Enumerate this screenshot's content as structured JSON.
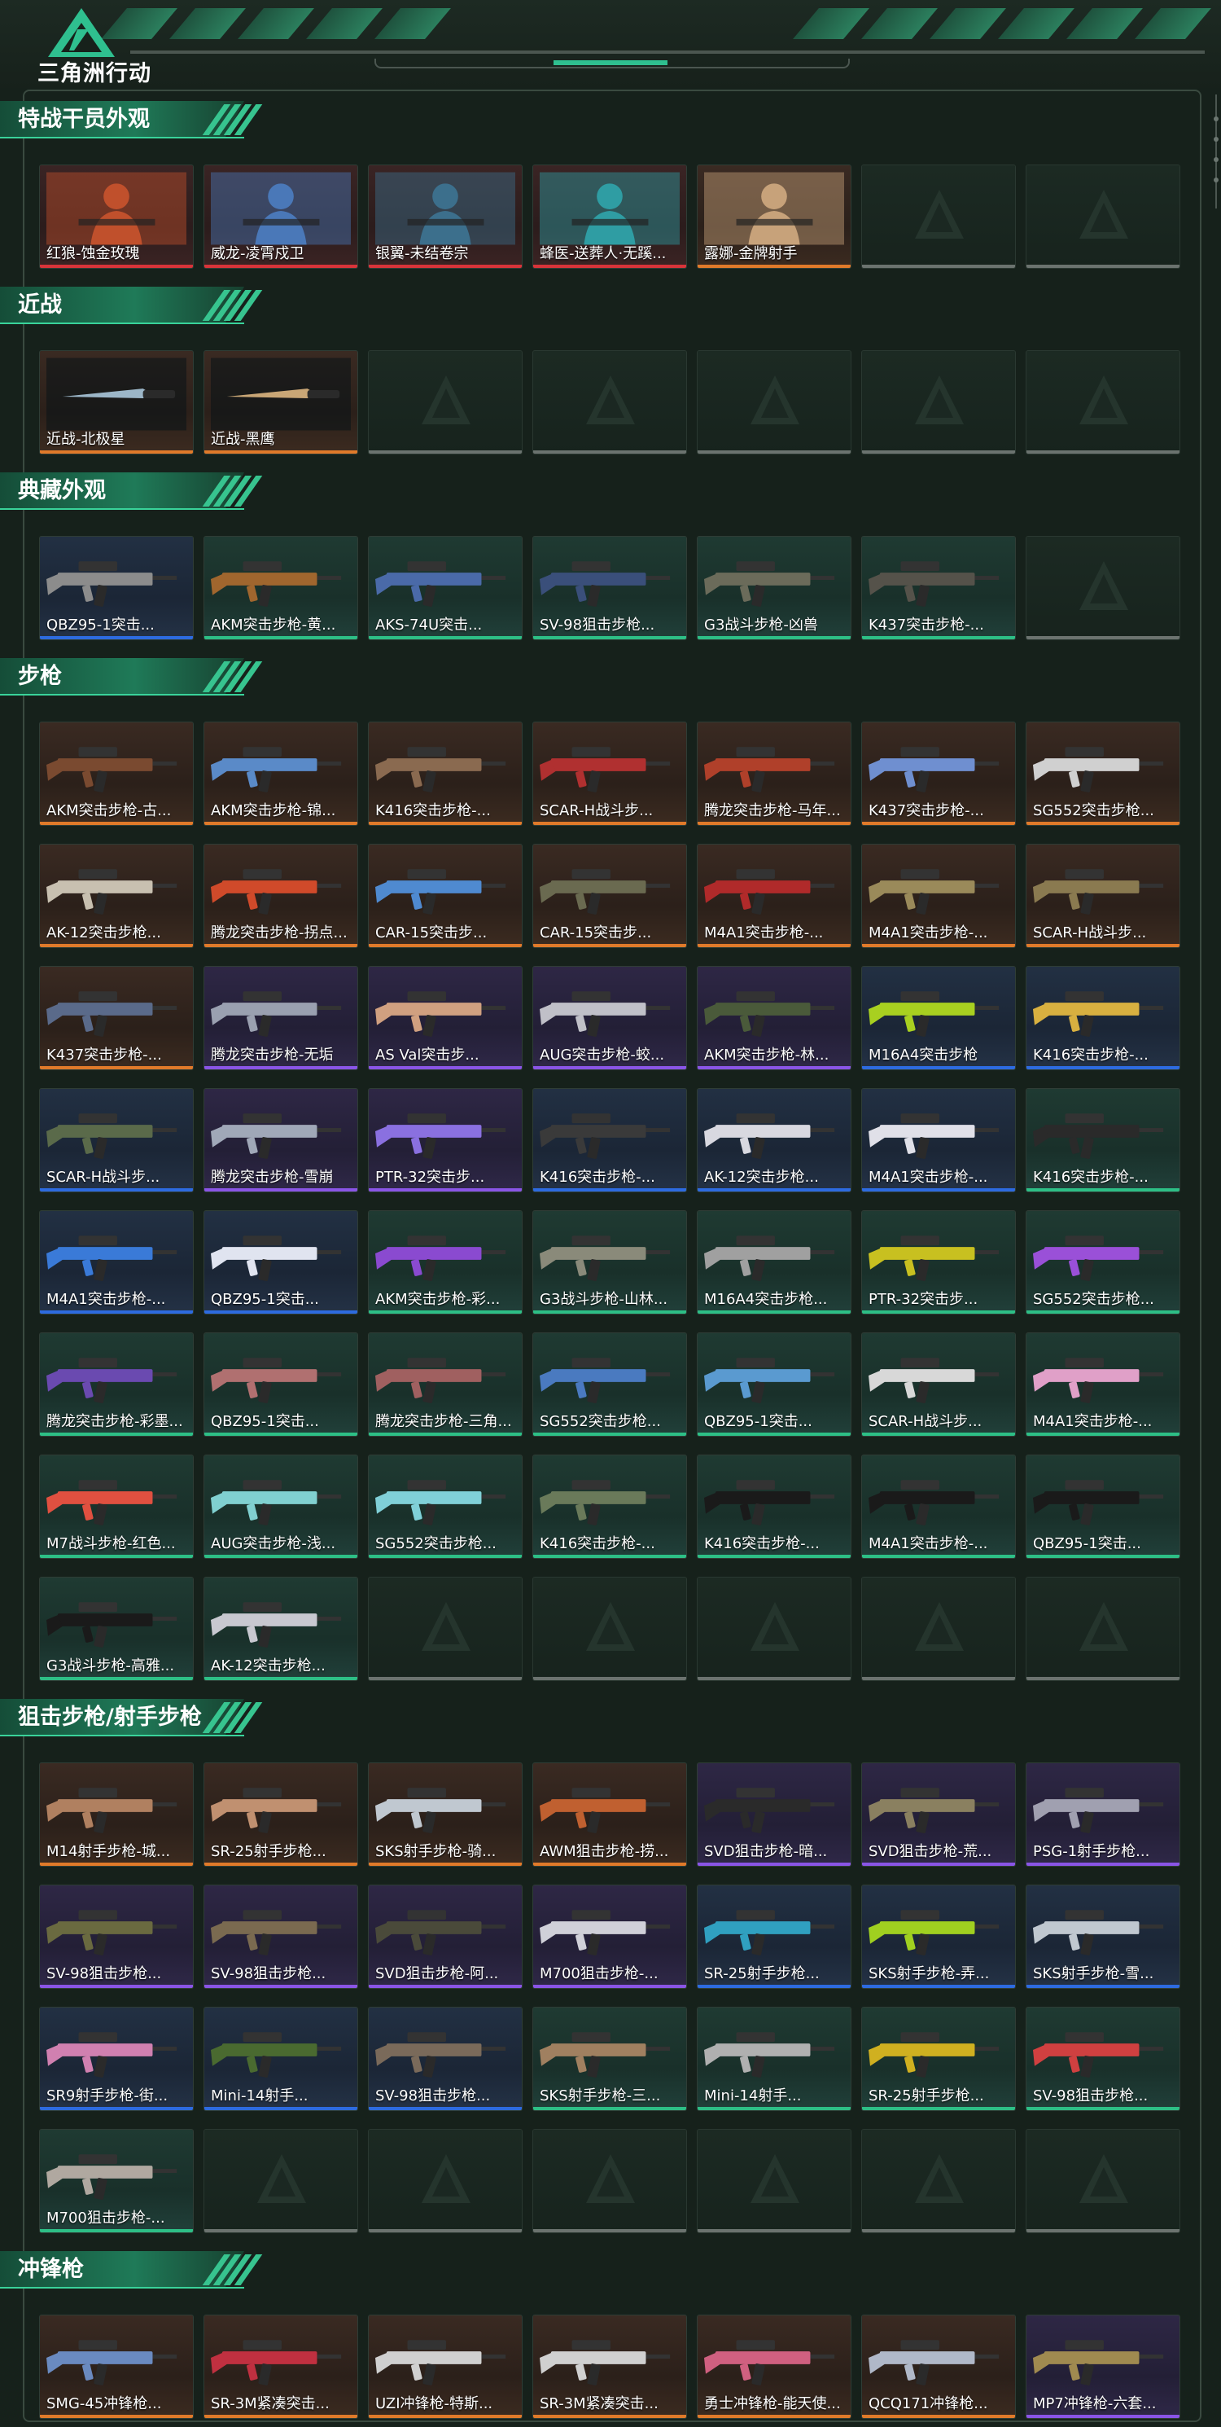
{
  "header": {
    "logo_text": "三角洲行动"
  },
  "colors": {
    "accent": "#2fbf8f",
    "rarity_orange": "#e07a2a",
    "rarity_purple": "#8a55e6",
    "rarity_blue": "#2d6be0",
    "rarity_green": "#2dbf86",
    "rarity_red": "#d8343a"
  },
  "sections": [
    {
      "title": "特战干员外观",
      "items": [
        {
          "name": "红狼-蚀金玫瑰",
          "rarity": "red",
          "kind": "operator",
          "color": "#c0502c"
        },
        {
          "name": "威龙-凌霄戍卫",
          "rarity": "red",
          "kind": "operator",
          "color": "#4a78b8"
        },
        {
          "name": "银翼-未结卷宗",
          "rarity": "red",
          "kind": "operator",
          "color": "#3c6f8c"
        },
        {
          "name": "蜂医-送葬人·无蹊...",
          "rarity": "red",
          "kind": "operator",
          "color": "#2f9da3"
        },
        {
          "name": "露娜-金牌射手",
          "rarity": "orange",
          "kind": "operator",
          "color": "#c7a27a"
        },
        {
          "empty": true
        },
        {
          "empty": true
        }
      ]
    },
    {
      "title": "近战",
      "items": [
        {
          "name": "近战-北极星",
          "rarity": "orange",
          "kind": "knife",
          "color": "#9cb6c8"
        },
        {
          "name": "近战-黑鹰",
          "rarity": "orange",
          "kind": "knife",
          "color": "#c9a676"
        },
        {
          "empty": true
        },
        {
          "empty": true
        },
        {
          "empty": true
        },
        {
          "empty": true
        },
        {
          "empty": true
        }
      ]
    },
    {
      "title": "典藏外观",
      "items": [
        {
          "name": "QBZ95-1突击...",
          "rarity": "blue",
          "kind": "gun",
          "color": "#8c8c8c"
        },
        {
          "name": "AKM突击步枪-黄...",
          "rarity": "green",
          "kind": "gun",
          "color": "#a0662e"
        },
        {
          "name": "AKS-74U突击...",
          "rarity": "green",
          "kind": "gun",
          "color": "#4a6aa8"
        },
        {
          "name": "SV-98狙击步枪...",
          "rarity": "green",
          "kind": "gun",
          "color": "#3a4f7a"
        },
        {
          "name": "G3战斗步枪-凶兽",
          "rarity": "green",
          "kind": "gun",
          "color": "#6b6b5a"
        },
        {
          "name": "K437突击步枪-...",
          "rarity": "green",
          "kind": "gun",
          "color": "#55524a"
        },
        {
          "empty": true
        }
      ]
    },
    {
      "title": "步枪",
      "items": [
        {
          "name": "AKM突击步枪-古...",
          "rarity": "orange",
          "kind": "gun",
          "color": "#7a4a30"
        },
        {
          "name": "AKM突击步枪-锦...",
          "rarity": "orange",
          "kind": "gun",
          "color": "#5a8ac8"
        },
        {
          "name": "K416突击步枪-...",
          "rarity": "orange",
          "kind": "gun",
          "color": "#8a6a50"
        },
        {
          "name": "SCAR-H战斗步...",
          "rarity": "orange",
          "kind": "gun",
          "color": "#b03030"
        },
        {
          "name": "腾龙突击步枪-马年...",
          "rarity": "orange",
          "kind": "gun",
          "color": "#b0402a"
        },
        {
          "name": "K437突击步枪-...",
          "rarity": "orange",
          "kind": "gun",
          "color": "#6f8fd0"
        },
        {
          "name": "SG552突击步枪...",
          "rarity": "orange",
          "kind": "gun",
          "color": "#d0d0d0"
        },
        {
          "name": "AK-12突击步枪...",
          "rarity": "orange",
          "kind": "gun",
          "color": "#c8c0b0"
        },
        {
          "name": "腾龙突击步枪-拐点...",
          "rarity": "orange",
          "kind": "gun",
          "color": "#d04a2a"
        },
        {
          "name": "CAR-15突击步...",
          "rarity": "orange",
          "kind": "gun",
          "color": "#4f8ad0"
        },
        {
          "name": "CAR-15突击步...",
          "rarity": "orange",
          "kind": "gun",
          "color": "#6a6a50"
        },
        {
          "name": "M4A1突击步枪-...",
          "rarity": "orange",
          "kind": "gun",
          "color": "#b02a2a"
        },
        {
          "name": "M4A1突击步枪-...",
          "rarity": "orange",
          "kind": "gun",
          "color": "#9a8a5a"
        },
        {
          "name": "SCAR-H战斗步...",
          "rarity": "orange",
          "kind": "gun",
          "color": "#8a7a50"
        },
        {
          "name": "K437突击步枪-...",
          "rarity": "orange",
          "kind": "gun",
          "color": "#5a6a8a"
        },
        {
          "name": "腾龙突击步枪-无垢",
          "rarity": "purple",
          "kind": "gun",
          "color": "#9aa0b0"
        },
        {
          "name": "AS Val突击步...",
          "rarity": "purple",
          "kind": "gun",
          "color": "#d0a080"
        },
        {
          "name": "AUG突击步枪-蛟...",
          "rarity": "purple",
          "kind": "gun",
          "color": "#c0c0c8"
        },
        {
          "name": "AKM突击步枪-林...",
          "rarity": "purple",
          "kind": "gun",
          "color": "#4a5a3a"
        },
        {
          "name": "M16A4突击步枪",
          "rarity": "blue",
          "kind": "gun",
          "color": "#a8d020"
        },
        {
          "name": "K416突击步枪-...",
          "rarity": "blue",
          "kind": "gun",
          "color": "#d8b040"
        },
        {
          "name": "SCAR-H战斗步...",
          "rarity": "blue",
          "kind": "gun",
          "color": "#5a6a4a"
        },
        {
          "name": "腾龙突击步枪-雪崩",
          "rarity": "purple",
          "kind": "gun",
          "color": "#a0a8b8"
        },
        {
          "name": "PTR-32突击步...",
          "rarity": "purple",
          "kind": "gun",
          "color": "#8a70e0"
        },
        {
          "name": "K416突击步枪-...",
          "rarity": "blue",
          "kind": "gun",
          "color": "#3a3a3a"
        },
        {
          "name": "AK-12突击步枪...",
          "rarity": "blue",
          "kind": "gun",
          "color": "#d8d8e0"
        },
        {
          "name": "M4A1突击步枪-...",
          "rarity": "blue",
          "kind": "gun",
          "color": "#e0e0e8"
        },
        {
          "name": "K416突击步枪-...",
          "rarity": "green",
          "kind": "gun",
          "color": "#2a2a2a"
        },
        {
          "name": "M4A1突击步枪-...",
          "rarity": "blue",
          "kind": "gun",
          "color": "#3a7ad8"
        },
        {
          "name": "QBZ95-1突击...",
          "rarity": "blue",
          "kind": "gun",
          "color": "#e0e4f0"
        },
        {
          "name": "AKM突击步枪-彩...",
          "rarity": "green",
          "kind": "gun",
          "color": "#8a4ad0"
        },
        {
          "name": "G3战斗步枪-山林...",
          "rarity": "green",
          "kind": "gun",
          "color": "#8a8a7a"
        },
        {
          "name": "M16A4突击步枪...",
          "rarity": "green",
          "kind": "gun",
          "color": "#a0a0a0"
        },
        {
          "name": "PTR-32突击步...",
          "rarity": "green",
          "kind": "gun",
          "color": "#c8c020"
        },
        {
          "name": "SG552突击步枪...",
          "rarity": "green",
          "kind": "gun",
          "color": "#9a50d8"
        },
        {
          "name": "腾龙突击步枪-彩墨...",
          "rarity": "green",
          "kind": "gun",
          "color": "#6a4ab0"
        },
        {
          "name": "QBZ95-1突击...",
          "rarity": "green",
          "kind": "gun",
          "color": "#b07070"
        },
        {
          "name": "腾龙突击步枪-三角...",
          "rarity": "green",
          "kind": "gun",
          "color": "#a06060"
        },
        {
          "name": "SG552突击步枪...",
          "rarity": "green",
          "kind": "gun",
          "color": "#4a7ac0"
        },
        {
          "name": "QBZ95-1突击...",
          "rarity": "green",
          "kind": "gun",
          "color": "#5a9ad0"
        },
        {
          "name": "SCAR-H战斗步...",
          "rarity": "green",
          "kind": "gun",
          "color": "#d8d8d8"
        },
        {
          "name": "M4A1突击步枪-...",
          "rarity": "green",
          "kind": "gun",
          "color": "#e0a0c8"
        },
        {
          "name": "M7战斗步枪-红色...",
          "rarity": "green",
          "kind": "gun",
          "color": "#e05040"
        },
        {
          "name": "AUG突击步枪-浅...",
          "rarity": "green",
          "kind": "gun",
          "color": "#80d0d0"
        },
        {
          "name": "SG552突击步枪...",
          "rarity": "green",
          "kind": "gun",
          "color": "#80d0d8"
        },
        {
          "name": "K416突击步枪-...",
          "rarity": "green",
          "kind": "gun",
          "color": "#6a7a5a"
        },
        {
          "name": "K416突击步枪-...",
          "rarity": "green",
          "kind": "gun",
          "color": "#1a1a1a"
        },
        {
          "name": "M4A1突击步枪-...",
          "rarity": "green",
          "kind": "gun",
          "color": "#1a1a1a"
        },
        {
          "name": "QBZ95-1突击...",
          "rarity": "green",
          "kind": "gun",
          "color": "#1a1a1a"
        },
        {
          "name": "G3战斗步枪-高雅...",
          "rarity": "green",
          "kind": "gun",
          "color": "#1a1a1a"
        },
        {
          "name": "AK-12突击步枪...",
          "rarity": "green",
          "kind": "gun",
          "color": "#c8c8d0"
        },
        {
          "empty": true
        },
        {
          "empty": true
        },
        {
          "empty": true
        },
        {
          "empty": true
        },
        {
          "empty": true
        }
      ]
    },
    {
      "title": "狙击步枪/射手步枪",
      "items": [
        {
          "name": "M14射手步枪-城...",
          "rarity": "orange",
          "kind": "gun",
          "color": "#b08060"
        },
        {
          "name": "SR-25射手步枪...",
          "rarity": "orange",
          "kind": "gun",
          "color": "#c09070"
        },
        {
          "name": "SKS射手步枪-骑...",
          "rarity": "orange",
          "kind": "gun",
          "color": "#c0c8d0"
        },
        {
          "name": "AWM狙击步枪-捞...",
          "rarity": "orange",
          "kind": "gun",
          "color": "#c06030"
        },
        {
          "name": "SVD狙击步枪-暗...",
          "rarity": "purple",
          "kind": "gun",
          "color": "#2a2a2a"
        },
        {
          "name": "SVD狙击步枪-荒...",
          "rarity": "purple",
          "kind": "gun",
          "color": "#8a8060"
        },
        {
          "name": "PSG-1射手步枪...",
          "rarity": "purple",
          "kind": "gun",
          "color": "#a0a0b0"
        },
        {
          "name": "SV-98狙击步枪...",
          "rarity": "purple",
          "kind": "gun",
          "color": "#6a6a40"
        },
        {
          "name": "SV-98狙击步枪...",
          "rarity": "purple",
          "kind": "gun",
          "color": "#7a6a50"
        },
        {
          "name": "SVD狙击步枪-阿...",
          "rarity": "purple",
          "kind": "gun",
          "color": "#4a4a3a"
        },
        {
          "name": "M700狙击步枪-...",
          "rarity": "purple",
          "kind": "gun",
          "color": "#d0d0d8"
        },
        {
          "name": "SR-25射手步枪...",
          "rarity": "blue",
          "kind": "gun",
          "color": "#30a0c0"
        },
        {
          "name": "SKS射手步枪-弄...",
          "rarity": "blue",
          "kind": "gun",
          "color": "#a0d020"
        },
        {
          "name": "SKS射手步枪-雪...",
          "rarity": "blue",
          "kind": "gun",
          "color": "#c0c8d0"
        },
        {
          "name": "SR9射手步枪-街...",
          "rarity": "blue",
          "kind": "gun",
          "color": "#d080b0"
        },
        {
          "name": "Mini-14射手...",
          "rarity": "blue",
          "kind": "gun",
          "color": "#4a6a30"
        },
        {
          "name": "SV-98狙击步枪...",
          "rarity": "blue",
          "kind": "gun",
          "color": "#7a6a5a"
        },
        {
          "name": "SKS射手步枪-三...",
          "rarity": "green",
          "kind": "gun",
          "color": "#a08060"
        },
        {
          "name": "Mini-14射手...",
          "rarity": "green",
          "kind": "gun",
          "color": "#b0b0b0"
        },
        {
          "name": "SR-25射手步枪...",
          "rarity": "green",
          "kind": "gun",
          "color": "#d0b020"
        },
        {
          "name": "SV-98狙击步枪...",
          "rarity": "green",
          "kind": "gun",
          "color": "#d04040"
        },
        {
          "name": "M700狙击步枪-...",
          "rarity": "green",
          "kind": "gun",
          "color": "#b0a8a0"
        },
        {
          "empty": true
        },
        {
          "empty": true
        },
        {
          "empty": true
        },
        {
          "empty": true
        },
        {
          "empty": true
        },
        {
          "empty": true
        }
      ]
    },
    {
      "title": "冲锋枪",
      "items": [
        {
          "name": "SMG-45冲锋枪...",
          "rarity": "orange",
          "kind": "gun",
          "color": "#6a8ac0"
        },
        {
          "name": "SR-3M紧凑突击...",
          "rarity": "orange",
          "kind": "gun",
          "color": "#c03040"
        },
        {
          "name": "UZI冲锋枪-特斯...",
          "rarity": "orange",
          "kind": "gun",
          "color": "#d0d0d0"
        },
        {
          "name": "SR-3M紧凑突击...",
          "rarity": "orange",
          "kind": "gun",
          "color": "#d0d0d0"
        },
        {
          "name": "勇士冲锋枪-能天使...",
          "rarity": "orange",
          "kind": "gun",
          "color": "#d06080"
        },
        {
          "name": "QCQ171冲锋枪...",
          "rarity": "orange",
          "kind": "gun",
          "color": "#b0b8c8"
        },
        {
          "name": "MP7冲锋枪-六套...",
          "rarity": "purple",
          "kind": "gun",
          "color": "#a08a50"
        }
      ]
    }
  ]
}
